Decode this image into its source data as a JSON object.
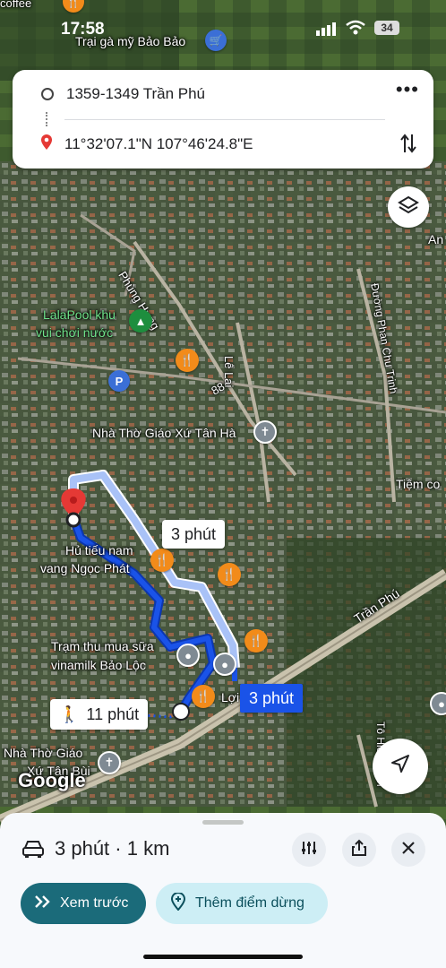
{
  "status_bar": {
    "time": "17:58",
    "battery": "34"
  },
  "map_labels": {
    "top_left_cut": "coffee",
    "poi_top": "Trại gà mỹ Bảo Bảo",
    "road_phung_hung": "Phùng Hưng",
    "road_le_lai": "Lê Lai",
    "road_phan_chu_trinh": "Đường Phan Chu Trinh",
    "road_88": "88",
    "lalapool_line1": "LalaPool khu",
    "lalapool_line2": "vui chơi nước",
    "church1": "Nhà Thờ Giáo Xứ Tân Hà",
    "tiem_cut": "Tiệm co",
    "an_cut": "An",
    "hutieu_line1": "Hủ tiếu nam",
    "hutieu_line2": "vang Ngọc Phát",
    "tram_line1": "Trạm thu mua sữa",
    "tram_line2": "vinamilk Bảo Lộc",
    "road_tran_phu": "Trần Phú",
    "loi_cut": "Lợi",
    "church2_line1": "Nhà Thờ Giáo",
    "church2_line2": "Xứ Tân Bùi",
    "road_to_hien_thanh": "Tô Hiến Thàn",
    "google_logo": "Google"
  },
  "route_card": {
    "origin": "1359-1349 Trần Phú",
    "destination": "11°32'07.1\"N 107°46'24.8\"E"
  },
  "map_chips": {
    "alt_route": "3 phút",
    "main_route": "3 phút",
    "walking": "11 phút"
  },
  "bottom_sheet": {
    "summary": "3 phút · 1 km",
    "preview_button": "Xem trước",
    "add_stop_button": "Thêm điểm dừng"
  },
  "colors": {
    "route_main": "#1a53e8",
    "route_alt": "#a9c2f7",
    "accent_button": "#1b6b7a",
    "secondary_button": "#cdeef5"
  }
}
